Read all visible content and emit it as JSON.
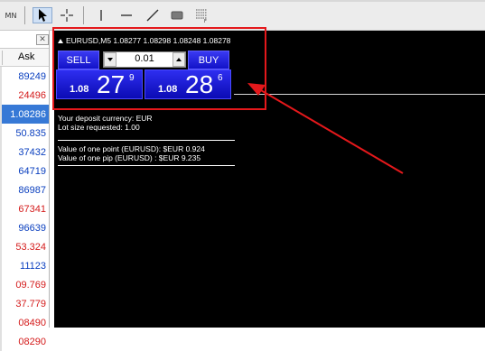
{
  "toolbar": {
    "label": "MN",
    "tools": [
      "cursor-tool",
      "crosshair-tool",
      "vertical-line-tool",
      "horizontal-line-tool",
      "trend-line-tool",
      "rectangle-tool",
      "fibonacci-tool"
    ]
  },
  "market_watch": {
    "column_header": "Ask",
    "close_glyph": "✕",
    "rows": [
      {
        "value": "89249",
        "direction": "up"
      },
      {
        "value": "24496",
        "direction": "down"
      },
      {
        "value": "1.08286",
        "direction": "selected"
      },
      {
        "value": "50.835",
        "direction": "up"
      },
      {
        "value": "37432",
        "direction": "up"
      },
      {
        "value": "64719",
        "direction": "up"
      },
      {
        "value": "86987",
        "direction": "up"
      },
      {
        "value": "67341",
        "direction": "down"
      },
      {
        "value": "96639",
        "direction": "up"
      },
      {
        "value": "53.324",
        "direction": "down"
      },
      {
        "value": "11123",
        "direction": "up"
      },
      {
        "value": "09.769",
        "direction": "down"
      },
      {
        "value": "37.779",
        "direction": "down"
      },
      {
        "value": "08490",
        "direction": "down"
      },
      {
        "value": "08290",
        "direction": "down"
      }
    ]
  },
  "chart": {
    "title": "EURUSD,M5  1.08277 1.08298 1.08248 1.08278",
    "background": "#000000"
  },
  "one_click": {
    "sell_label": "SELL",
    "buy_label": "BUY",
    "lot_value": "0.01",
    "sell_quote": {
      "prefix": "1.08",
      "big": "27",
      "sup": "9"
    },
    "buy_quote": {
      "prefix": "1.08",
      "big": "28",
      "sup": "6"
    }
  },
  "info": {
    "line1": "Your deposit currency: EUR",
    "line2": "Lot size requested: 1.00",
    "line3": "Value of one point (EURUSD):  $EUR 0.924",
    "line4": "Value of one pip    (EURUSD) : $EUR 9.235"
  },
  "annotation": {
    "color": "#e4181b"
  }
}
